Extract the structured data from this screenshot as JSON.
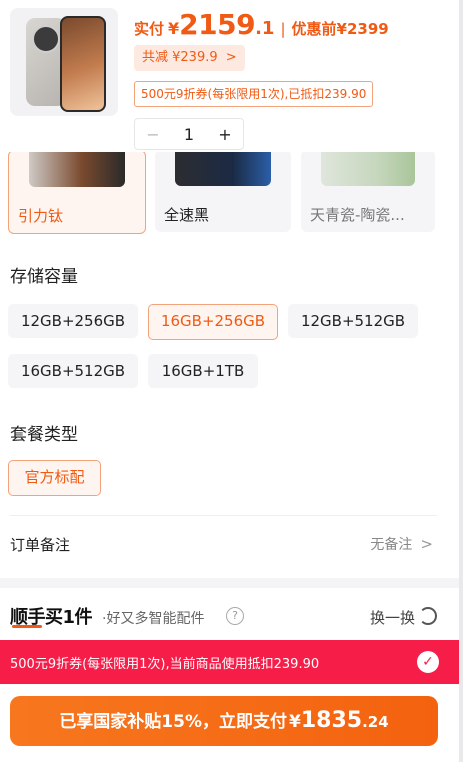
{
  "header": {
    "price_label": "实付",
    "currency": "¥",
    "price_int": "2159",
    "price_dec": ".1",
    "separator": "|",
    "orig_label": "优惠前",
    "orig_price": "¥2399",
    "reduce_label": "共减 ¥239.9",
    "reduce_chevron": ">",
    "coupon_text": "500元9折券(每张限用1次),已抵扣239.90",
    "qty_minus": "−",
    "qty_value": "1",
    "qty_plus": "+"
  },
  "colors": [
    {
      "label": "引力钛"
    },
    {
      "label": "全速黑"
    },
    {
      "label": "天青瓷-陶瓷..."
    }
  ],
  "storage": {
    "title": "存储容量",
    "options": [
      {
        "label": "12GB+256GB"
      },
      {
        "label": "16GB+256GB"
      },
      {
        "label": "12GB+512GB"
      },
      {
        "label": "16GB+512GB"
      },
      {
        "label": "16GB+1TB"
      }
    ],
    "selected": "16GB+256GB"
  },
  "package": {
    "title": "套餐类型",
    "options": [
      {
        "label": "官方标配"
      }
    ]
  },
  "remark": {
    "label": "订单备注",
    "value": "无备注",
    "chevron": ">"
  },
  "bundle": {
    "brand": "顺手买1件",
    "sub": "·好又多智能配件",
    "help": "?",
    "swap": "换一换"
  },
  "promo": {
    "text": "500元9折券(每张限用1次),当前商品使用抵扣239.90",
    "check": "✓"
  },
  "pay": {
    "text": "已享国家补贴15%，立即支付",
    "currency": "¥",
    "int": "1835",
    "dec": ".24"
  },
  "theme": {
    "accent": "#f05a14",
    "promo_red": "#f61e49",
    "button_orange": "#f4620f"
  }
}
